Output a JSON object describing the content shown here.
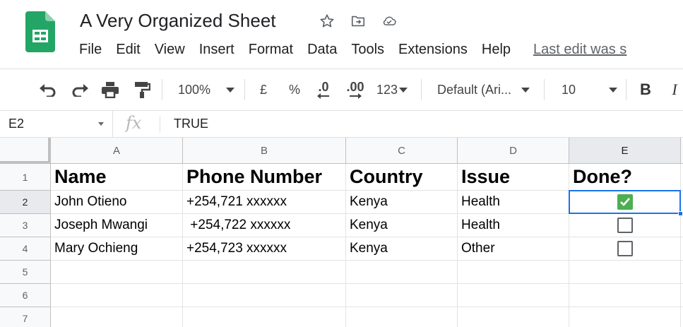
{
  "doc": {
    "title": "A Very Organized Sheet",
    "last_edit": "Last edit was s"
  },
  "menu": [
    "File",
    "Edit",
    "View",
    "Insert",
    "Format",
    "Data",
    "Tools",
    "Extensions",
    "Help"
  ],
  "toolbar": {
    "zoom": "100%",
    "currency": "£",
    "percent": "%",
    "decrease_decimal": ".0",
    "increase_decimal": ".00",
    "more_formats": "123",
    "font": "Default (Ari...",
    "font_size": "10",
    "bold": "B",
    "italic": "I"
  },
  "formula_bar": {
    "cell_ref": "E2",
    "fx": "fx",
    "value": "TRUE"
  },
  "grid": {
    "columns": [
      "A",
      "B",
      "C",
      "D",
      "E"
    ],
    "rows": [
      "1",
      "2",
      "3",
      "4",
      "5",
      "6",
      "7"
    ],
    "header": [
      "Name",
      "Phone Number",
      "Country",
      "Issue",
      "Done?"
    ],
    "data": [
      {
        "name": "John Otieno",
        "phone": "+254,721 xxxxxx",
        "country": "Kenya",
        "issue": "Health",
        "done": true
      },
      {
        "name": "Joseph Mwangi",
        "phone": " +254,722 xxxxxx",
        "country": "Kenya",
        "issue": "Health",
        "done": false
      },
      {
        "name": "Mary Ochieng",
        "phone": "+254,723 xxxxxx",
        "country": "Kenya",
        "issue": "Other",
        "done": false
      }
    ],
    "selected_cell": "E2"
  },
  "colors": {
    "sheets_green": "#23a566",
    "selection_blue": "#1a73e8",
    "checkbox_checked": "#4caf50"
  }
}
